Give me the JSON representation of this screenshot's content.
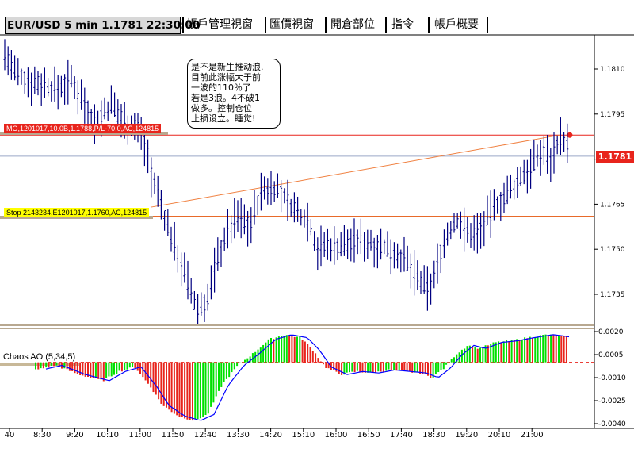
{
  "toolbar": {
    "symbol_tab": "EUR/USD 5 min 1.1781 22:30:00",
    "tabs": [
      "帳戶管理視窗",
      "匯價視窗",
      "開倉部位",
      "指令",
      "帳戶概要"
    ]
  },
  "chart_data": [
    {
      "type": "candlestick",
      "title": "EUR/USD 5 min 1.1781 22:30:00",
      "ylim": [
        1.1726,
        1.1822
      ],
      "yticks": [
        1.181,
        1.1795,
        1.178,
        1.1765,
        1.175,
        1.1735
      ],
      "ytick_labels": [
        "1.1810",
        "1.1795",
        "",
        "1.1765",
        "1.1750",
        "1.1735"
      ],
      "xtick_labels": [
        "40",
        "8:30",
        "9:20",
        "10:10",
        "11:00",
        "11:50",
        "12:40",
        "13:30",
        "14:20",
        "15:10",
        "16:00",
        "16:50",
        "17:40",
        "18:30",
        "19:20",
        "20:10",
        "21:00"
      ],
      "current_price": "1.1781",
      "colors": {
        "candle": "#000080",
        "mo_line": "#e8241c",
        "stop_line": "#e86a2a",
        "trend_line": "#f08040",
        "price_line": "#9aa6c8"
      },
      "levels": {
        "mo": 1.1788,
        "stop": 1.1761,
        "current": 1.1781
      },
      "trend_line": {
        "from": 1.1764,
        "to": 1.1788
      },
      "annotations": {
        "note": "是不是新生推动浪.\n目前此涨幅大于前\n一波的110％了\n若是3浪。4不破1\n做多。控制仓位\n止损设立。睡觉!",
        "mo_order": "MO,1201017,10.0B,1.1788,P/L-70.0,AC,124815",
        "stop_order": "Stop 2143234,E1201017,1.1760,AC,124815"
      }
    },
    {
      "type": "bar",
      "title": "Chaos AO (5,34,5)",
      "ylim": [
        -0.0043,
        0.0023
      ],
      "yticks": [
        0.002,
        0.0005,
        -0.001,
        -0.0025,
        -0.004
      ],
      "ytick_labels": [
        "0.0020",
        "0.0005",
        "-0.0010",
        "-0.0025",
        "-0.0040"
      ],
      "colors": {
        "up": "#00e000",
        "down": "#e8241c",
        "signal": "#0000ff"
      }
    }
  ]
}
